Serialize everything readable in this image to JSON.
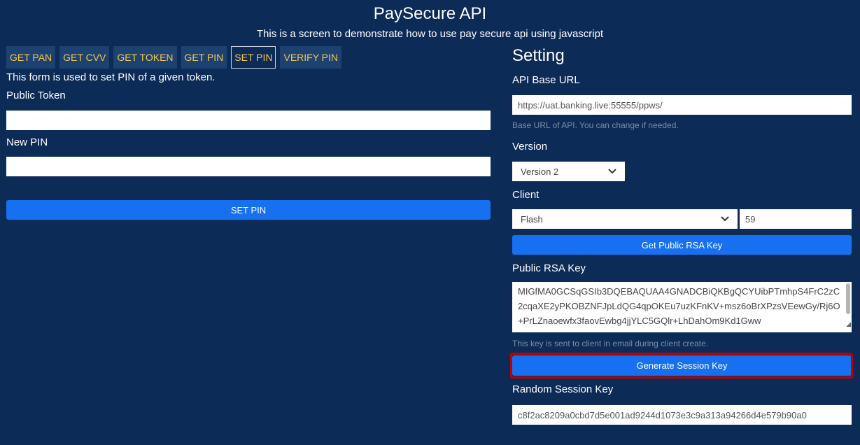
{
  "header": {
    "title": "PaySecure API",
    "subtitle": "This is a screen to demonstrate how to use pay secure api using javascript"
  },
  "tabs": [
    {
      "label": "GET PAN"
    },
    {
      "label": "GET CVV"
    },
    {
      "label": "GET TOKEN"
    },
    {
      "label": "GET PIN"
    },
    {
      "label": "SET PIN",
      "active": true
    },
    {
      "label": "VERIFY PIN"
    }
  ],
  "form": {
    "description": "This form is used to set PIN of a given token.",
    "public_token_label": "Public Token",
    "public_token_value": "",
    "new_pin_label": "New PIN",
    "new_pin_value": "",
    "submit_label": "SET PIN"
  },
  "settings": {
    "title": "Setting",
    "api_base_url_label": "API Base URL",
    "api_base_url_value": "https://uat.banking.live:55555/ppws/",
    "api_base_url_hint": "Base URL of API. You can change if needed.",
    "version_label": "Version",
    "version_selected": "Version 2",
    "client_label": "Client",
    "client_selected": "Flash",
    "client_id_value": "59",
    "get_rsa_key_label": "Get Public RSA Key",
    "public_rsa_key_label": "Public RSA Key",
    "public_rsa_key_value": "MIGfMA0GCSqGSIb3DQEBAQUAA4GNADCBiQKBgQCYUibPTmhpS4FrC2zC2cqaXE2yPKOBZNFJpLdQG4qpOKEu7uzKFnKV+msz6oBrXPzsVEewGy/Rj6O+PrLZnaoewfx3faovEwbg4jjYLC5GQlr+LhDahOm9Kd1Gww",
    "public_rsa_key_hint": "This key is sent to client in email during client create.",
    "generate_session_key_label": "Generate Session Key",
    "random_session_key_label": "Random Session Key",
    "random_session_key_value": "c8f2ac8209a0cbd7d5e001ad9244d1073e3c9a313a94266d4e579b90a0"
  },
  "colors": {
    "background": "#0d2b57",
    "tab_text": "#f2c94c",
    "primary_button": "#1670f0",
    "highlight": "#c00000"
  },
  "icons": {
    "select_chevron": "chevron-down-icon"
  }
}
